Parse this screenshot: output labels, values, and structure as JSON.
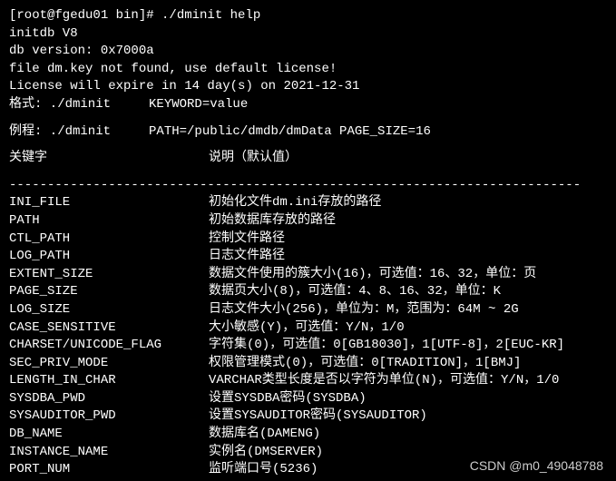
{
  "prompt": "[root@fgedu01 bin]# ./dminit help",
  "lines": [
    "initdb V8",
    "db version: 0x7000a",
    "file dm.key not found, use default license!",
    "License will expire in 14 day(s) on 2021-12-31"
  ],
  "format_label": "格式: ./dminit     KEYWORD=value",
  "example_label": "例程: ./dminit     PATH=/public/dmdb/dmData PAGE_SIZE=16",
  "header": {
    "key": "关键字",
    "desc": "说明（默认值）"
  },
  "divider": "---------------------------------------------------------------------------",
  "params": [
    {
      "key": "INI_FILE",
      "desc": "初始化文件dm.ini存放的路径"
    },
    {
      "key": "PATH",
      "desc": "初始数据库存放的路径"
    },
    {
      "key": "CTL_PATH",
      "desc": "控制文件路径"
    },
    {
      "key": "LOG_PATH",
      "desc": "日志文件路径"
    },
    {
      "key": "EXTENT_SIZE",
      "desc": "数据文件使用的簇大小(16)，可选值：16、32，单位：页"
    },
    {
      "key": "PAGE_SIZE",
      "desc": "数据页大小(8)，可选值：4、8、16、32，单位：K"
    },
    {
      "key": "LOG_SIZE",
      "desc": "日志文件大小(256)，单位为：M，范围为：64M ~ 2G"
    },
    {
      "key": "CASE_SENSITIVE",
      "desc": "大小敏感(Y)，可选值：Y/N，1/0"
    },
    {
      "key": "CHARSET/UNICODE_FLAG",
      "desc": "字符集(0)，可选值：0[GB18030]，1[UTF-8]，2[EUC-KR]"
    },
    {
      "key": "SEC_PRIV_MODE",
      "desc": "权限管理模式(0)，可选值：0[TRADITION]，1[BMJ]"
    },
    {
      "key": "LENGTH_IN_CHAR",
      "desc": "VARCHAR类型长度是否以字符为单位(N)，可选值：Y/N，1/0"
    },
    {
      "key": "SYSDBA_PWD",
      "desc": "设置SYSDBA密码(SYSDBA)"
    },
    {
      "key": "SYSAUDITOR_PWD",
      "desc": "设置SYSAUDITOR密码(SYSAUDITOR)"
    },
    {
      "key": "DB_NAME",
      "desc": "数据库名(DAMENG)"
    },
    {
      "key": "INSTANCE_NAME",
      "desc": "实例名(DMSERVER)"
    },
    {
      "key": "PORT_NUM",
      "desc": "监听端口号(5236)"
    }
  ],
  "watermark": "CSDN @m0_49048788"
}
